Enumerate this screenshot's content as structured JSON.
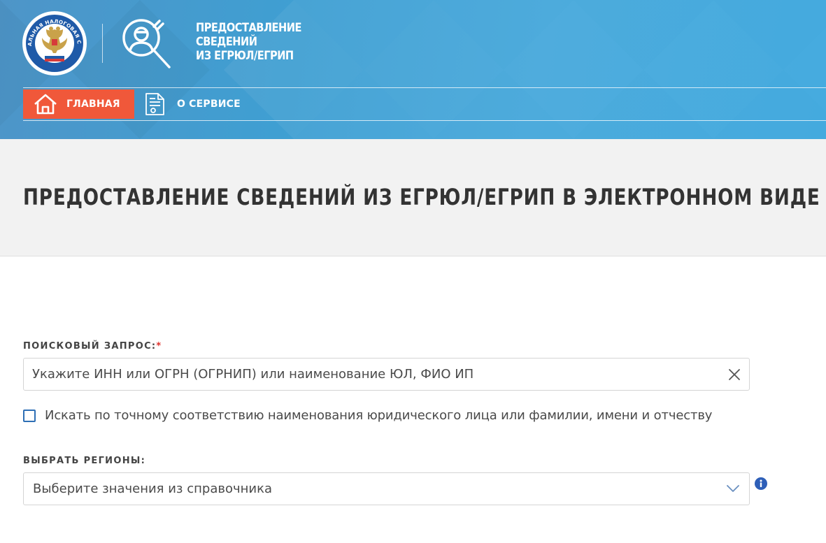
{
  "header": {
    "emblem_text": "ФЕДЕРАЛЬНАЯ НАЛОГОВАЯ СЛУЖБА",
    "service_title_lines": [
      "ПРЕДОСТАВЛЕНИЕ",
      "СВЕДЕНИЙ",
      "ИЗ ЕГРЮЛ/ЕГРИП"
    ],
    "nav": {
      "home_label": "ГЛАВНАЯ",
      "home_icon": "house-icon",
      "about_label": "О СЕРВИСЕ",
      "about_icon": "document-icon"
    }
  },
  "page": {
    "title": "ПРЕДОСТАВЛЕНИЕ СВЕДЕНИЙ ИЗ ЕГРЮЛ/ЕГРИП В ЭЛЕКТРОННОМ ВИДЕ"
  },
  "form": {
    "query": {
      "label": "ПОИСКОВЫЙ ЗАПРОС:",
      "required_mark": "*",
      "placeholder": "Укажите ИНН или ОГРН (ОГРНИП) или наименование ЮЛ, ФИО ИП",
      "value": ""
    },
    "exact_match": {
      "label": "Искать по точному соответствию наименования юридического лица или фамилии, имени и отчеству",
      "checked": false
    },
    "regions": {
      "label": "ВЫБРАТЬ РЕГИОНЫ:",
      "selected": "Выберите значения из справочника"
    }
  },
  "colors": {
    "header_blue": "#44a7db",
    "nav_active": "#f0583a",
    "title_band": "#f2f2f2",
    "required": "#e0312b",
    "checkbox_border": "#2e6fb5",
    "info_icon": "#2e5fb8"
  }
}
